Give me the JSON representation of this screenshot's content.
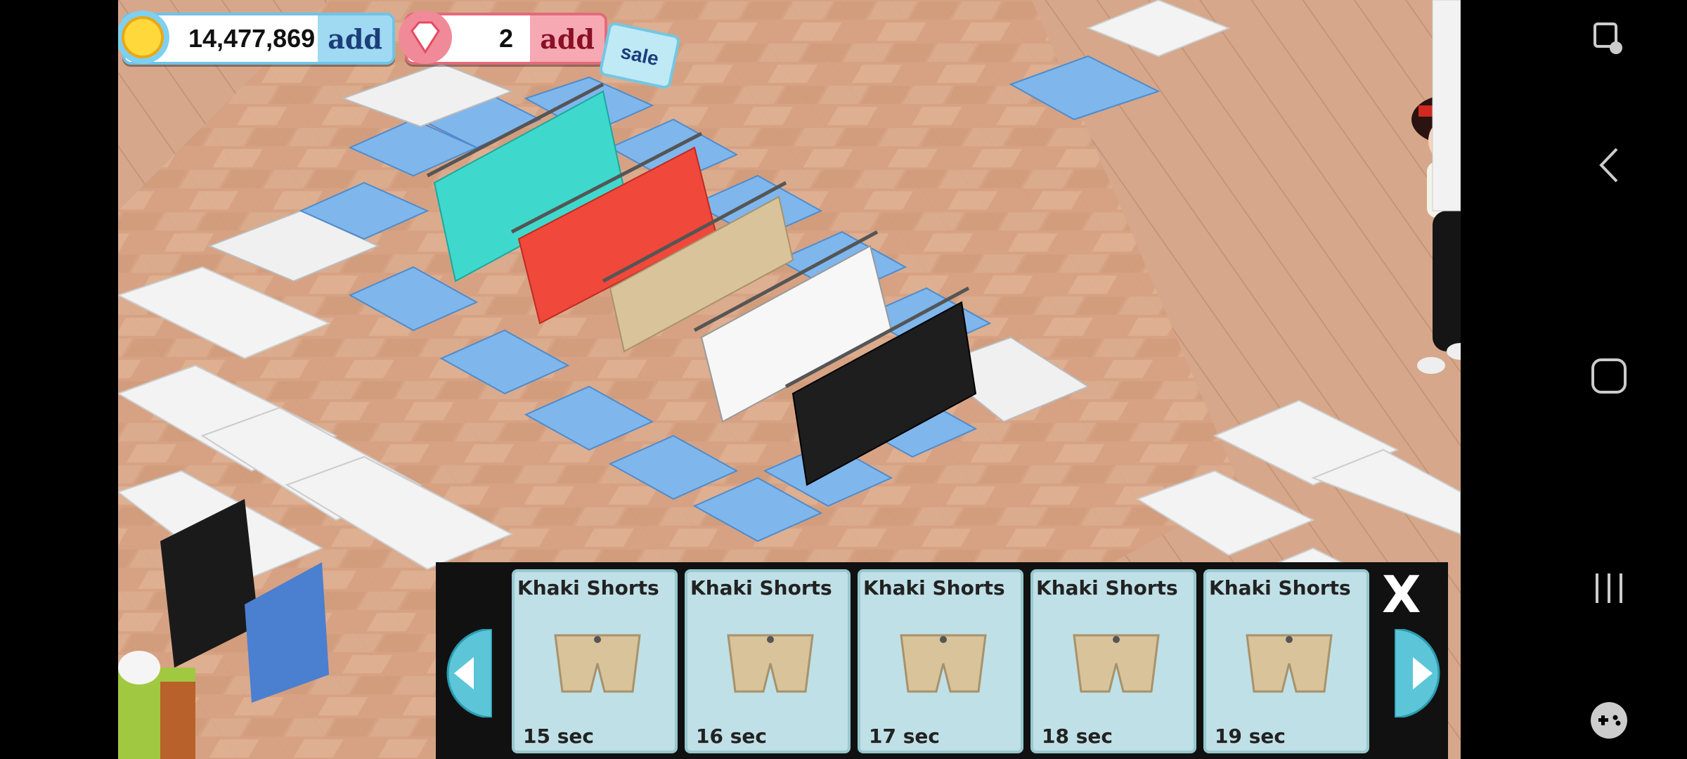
{
  "hud": {
    "coins": "14,477,869",
    "coins_add": "add",
    "gems": "2",
    "gems_add": "add",
    "sale": "sale"
  },
  "crafting_panel": {
    "items": [
      {
        "name": "Khaki Shorts",
        "time": "15 sec"
      },
      {
        "name": "Khaki Shorts",
        "time": "16 sec"
      },
      {
        "name": "Khaki Shorts",
        "time": "17 sec"
      },
      {
        "name": "Khaki Shorts",
        "time": "18 sec"
      },
      {
        "name": "Khaki Shorts",
        "time": "19 sec"
      }
    ],
    "close_label": "X"
  },
  "colors": {
    "floor": "#d9a98a",
    "counter_blue": "#7fb6ec",
    "counter_white": "#f2f2f2",
    "rack_teal": "#3fd8cc",
    "rack_red": "#f0483a",
    "rack_khaki": "#d9c39a"
  },
  "icons": [
    "coin-icon",
    "gem-icon",
    "sale-tag-icon",
    "shorts-icon",
    "left-arrow-icon",
    "right-arrow-icon",
    "close-icon",
    "screenshot-icon",
    "back-icon",
    "home-icon",
    "recents-icon",
    "game-controller-icon"
  ]
}
